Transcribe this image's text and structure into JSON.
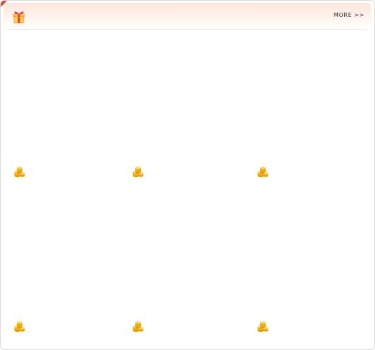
{
  "header": {
    "icon": "gift-icon",
    "more_label": "MORE >>"
  },
  "items": [
    {
      "icon": "coins-icon",
      "price": ""
    },
    {
      "icon": "coins-icon",
      "price": ""
    },
    {
      "icon": "coins-icon",
      "price": ""
    },
    {
      "icon": "coins-icon",
      "price": ""
    },
    {
      "icon": "coins-icon",
      "price": ""
    },
    {
      "icon": "coins-icon",
      "price": ""
    }
  ],
  "colors": {
    "accent": "#e8432b",
    "header_tint": "#fde7dc",
    "coin": "#f5b50f"
  }
}
